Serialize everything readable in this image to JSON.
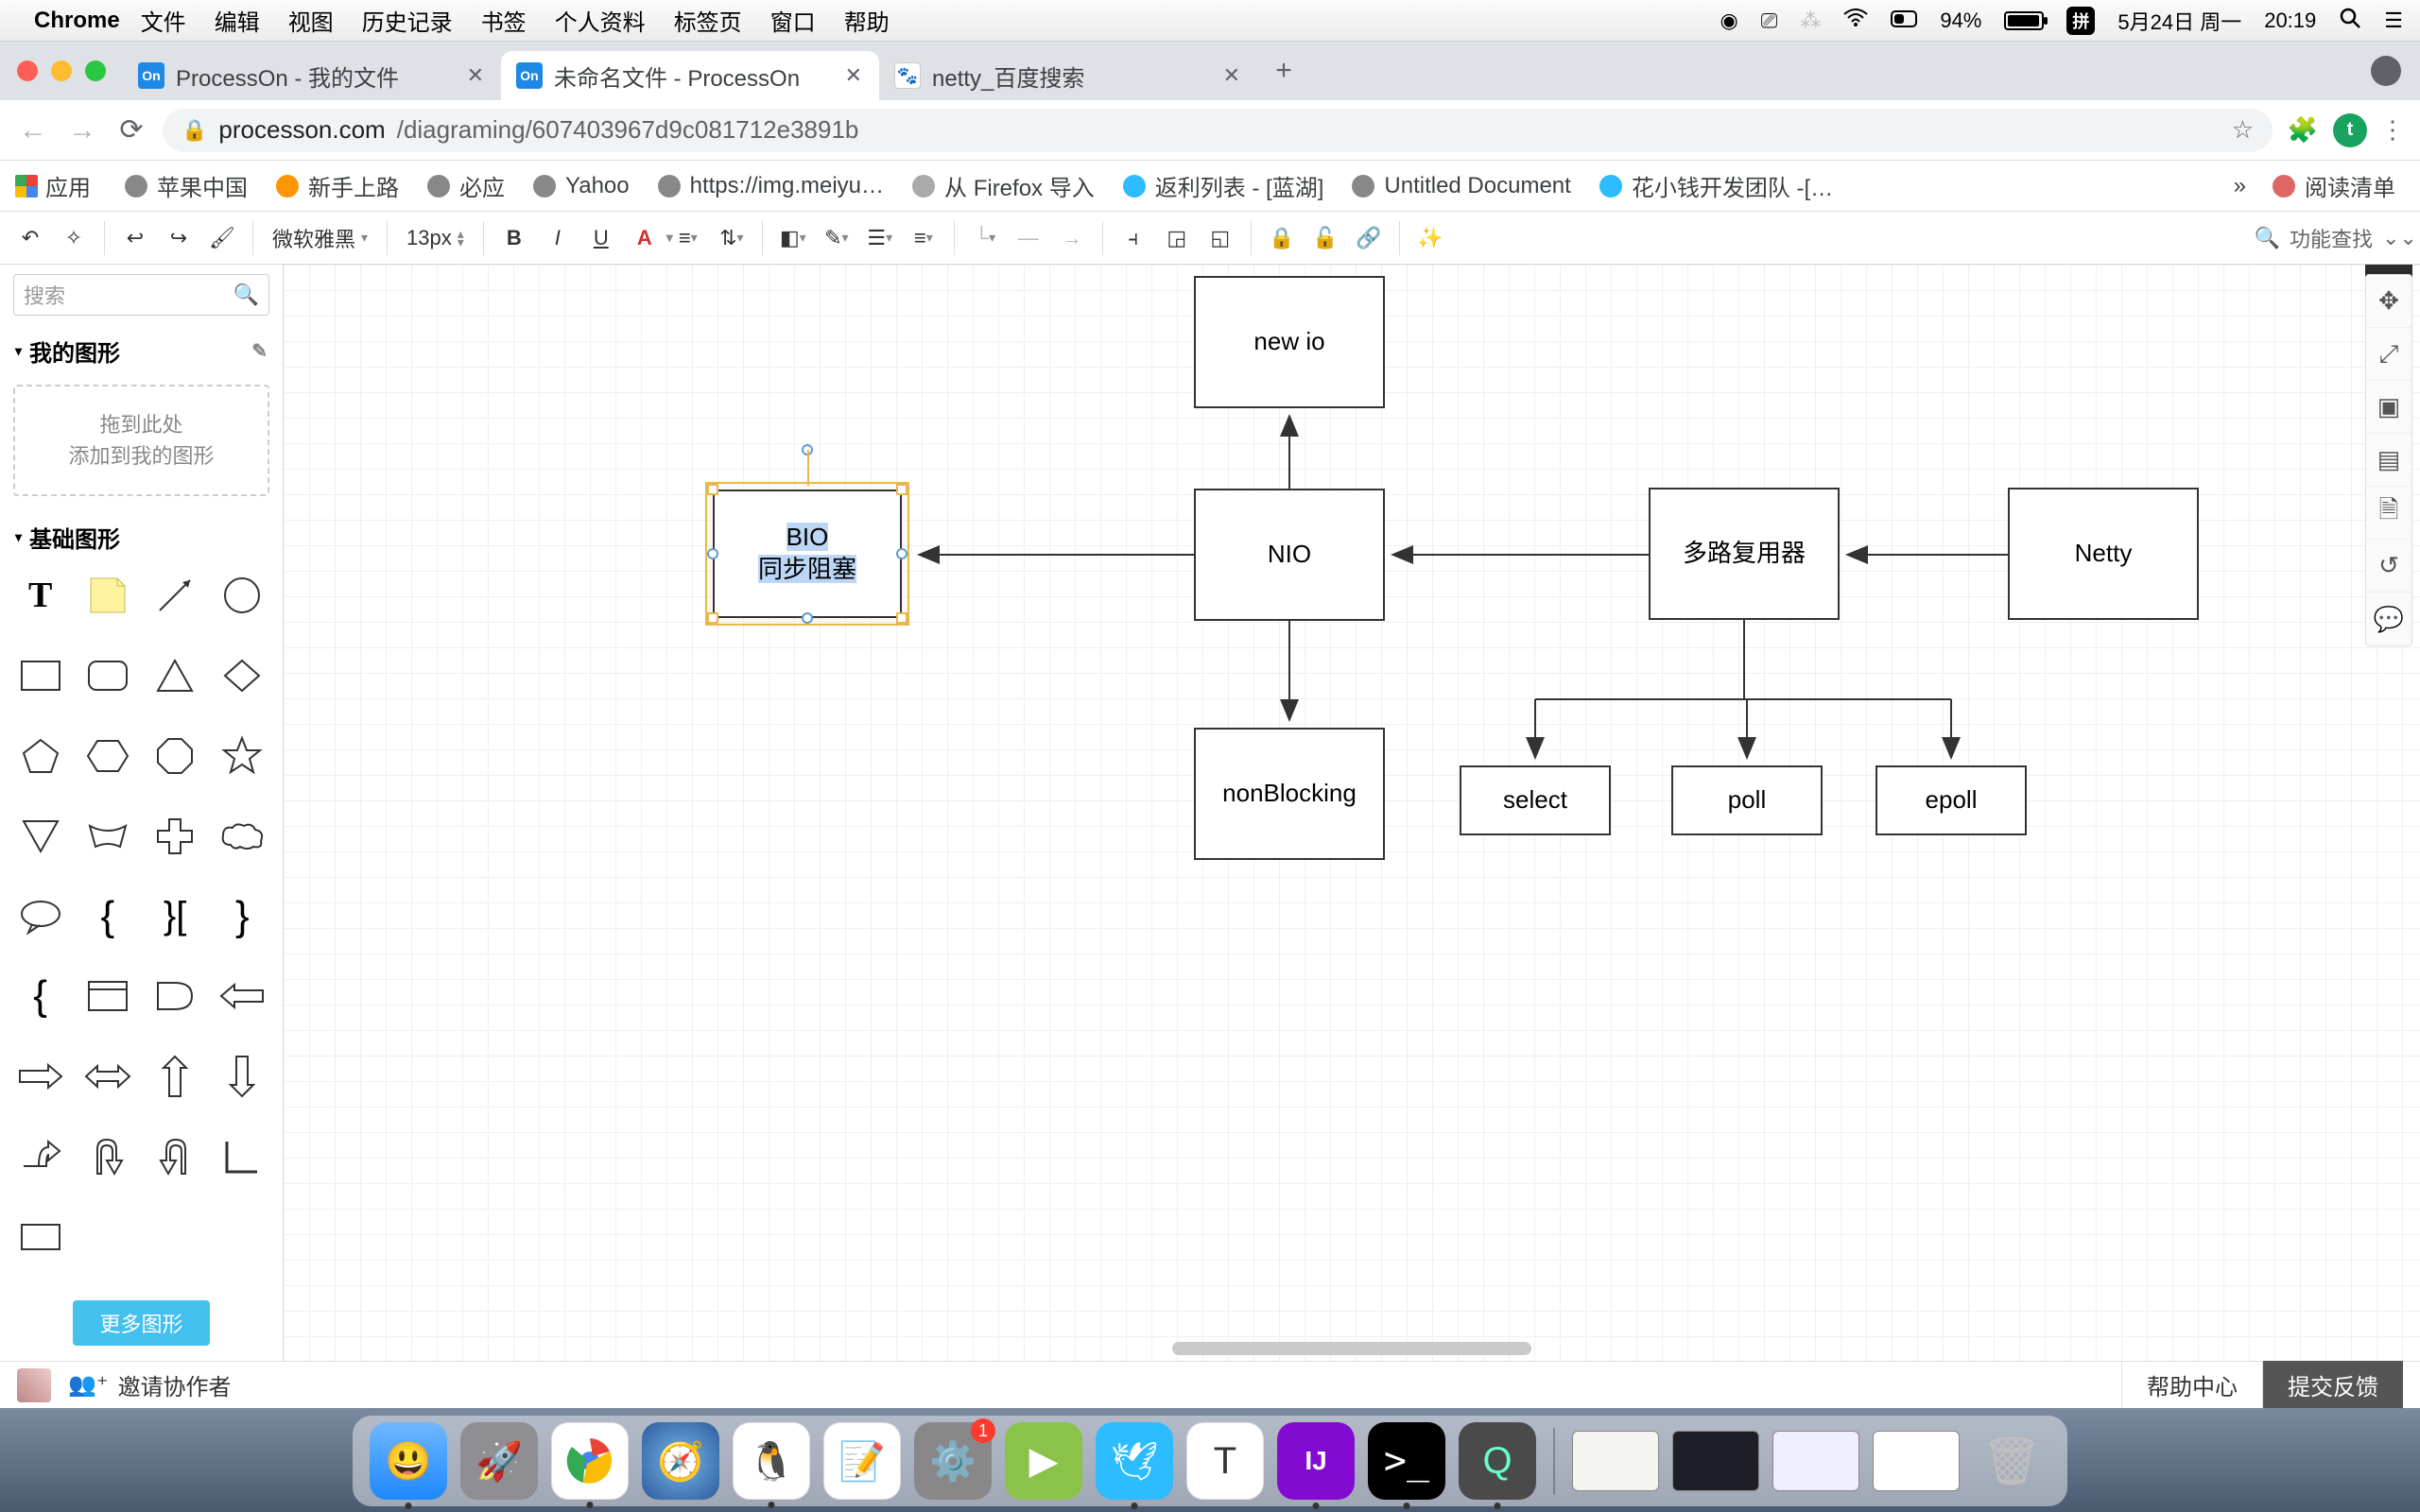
{
  "menubar": {
    "app": "Chrome",
    "items": [
      "文件",
      "编辑",
      "视图",
      "历史记录",
      "书签",
      "个人资料",
      "标签页",
      "窗口",
      "帮助"
    ],
    "battery_pct": "94%",
    "date": "5月24日 周一",
    "time": "20:19",
    "ime": "拼"
  },
  "tabs": [
    {
      "title": "ProcessOn - 我的文件",
      "favicon": "On"
    },
    {
      "title": "未命名文件 - ProcessOn",
      "favicon": "On",
      "active": true
    },
    {
      "title": "netty_百度搜索",
      "favicon": "paw"
    }
  ],
  "url": {
    "host": "processon.com",
    "path": "/diagraming/607403967d9c081712e3891b"
  },
  "bookmarks": {
    "apps_label": "应用",
    "items": [
      "苹果中国",
      "新手上路",
      "必应",
      "Yahoo",
      "https://img.meiyu…",
      "从 Firefox 导入",
      "返利列表 - [蓝湖]",
      "Untitled Document",
      "花小钱开发团队 -[…"
    ],
    "reading_list": "阅读清单",
    "more": "»"
  },
  "toolbar": {
    "font": "微软雅黑",
    "size": "13px",
    "search_label": "功能查找"
  },
  "sidebar": {
    "search_placeholder": "搜索",
    "my_shapes": "我的图形",
    "dropzone_l1": "拖到此处",
    "dropzone_l2": "添加到我的图形",
    "basic_shapes": "基础图形",
    "more": "更多图形"
  },
  "canvas": {
    "nodes": {
      "bio_l1": "BIO",
      "bio_l2": "同步阻塞",
      "newio": "new io",
      "nio": "NIO",
      "nonblocking": "nonBlocking",
      "mux": "多路复用器",
      "netty": "Netty",
      "select": "select",
      "poll": "poll",
      "epoll": "epoll"
    }
  },
  "bottom": {
    "invite": "邀请协作者",
    "help": "帮助中心",
    "feedback": "提交反馈"
  }
}
